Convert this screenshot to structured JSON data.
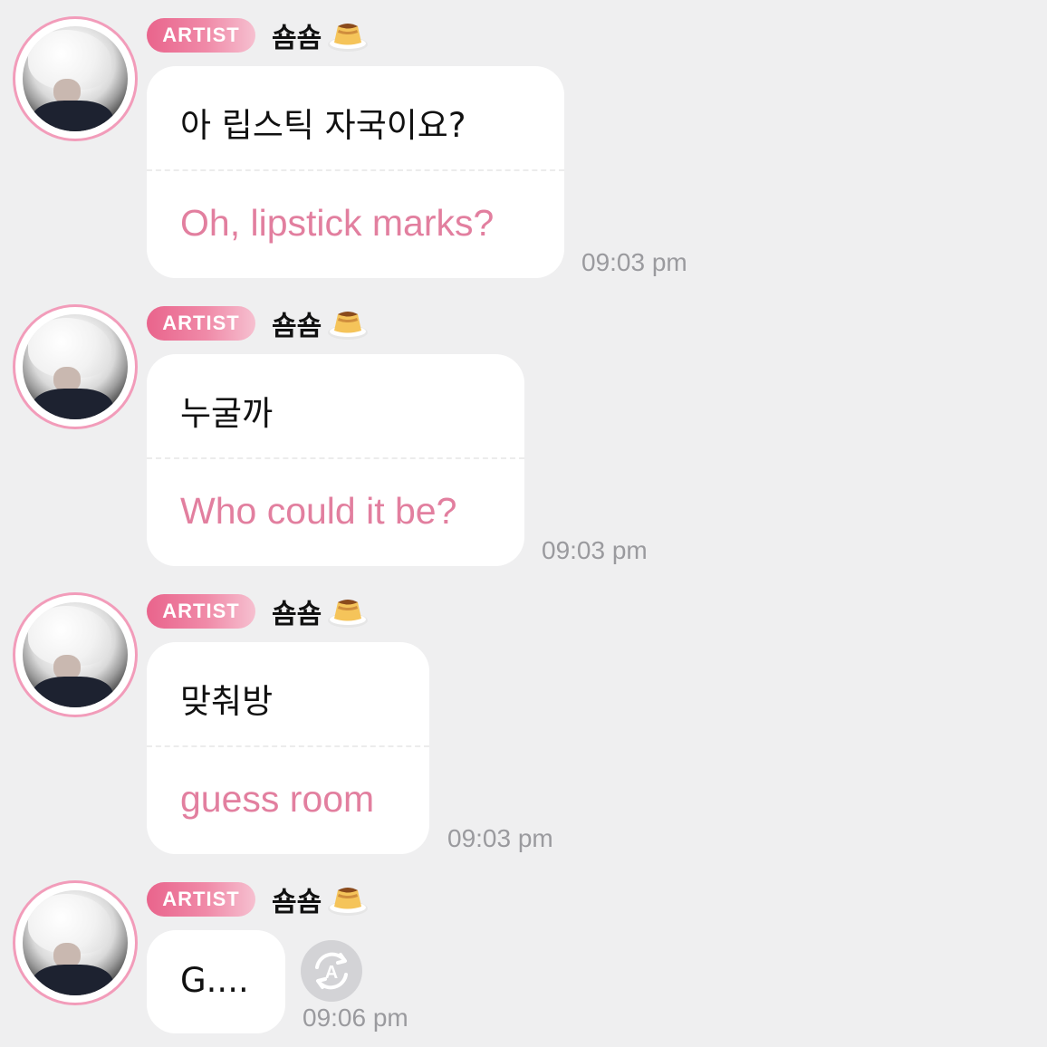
{
  "messages": [
    {
      "badge": "ARTIST",
      "username": "숌숌",
      "original": "아 립스틱 자국이요?",
      "translation": "Oh, lipstick marks?",
      "time": "09:03 pm"
    },
    {
      "badge": "ARTIST",
      "username": "숌숌",
      "original": "누굴까",
      "translation": "Who could it be?",
      "time": "09:03 pm"
    },
    {
      "badge": "ARTIST",
      "username": "숌숌",
      "original": "맞춰방",
      "translation": "guess room",
      "time": "09:03 pm"
    },
    {
      "badge": "ARTIST",
      "username": "숌숌",
      "original": "G....",
      "translation": "",
      "time": "09:06 pm"
    }
  ],
  "icons": {
    "username_emoji": "custard-pudding-icon",
    "translate_button": "translate-icon"
  },
  "colors": {
    "background": "#efeff0",
    "bubble": "#ffffff",
    "badge_gradient_start": "#e9648c",
    "translation_text": "#e27f9f",
    "timestamp": "#9a9a9e",
    "avatar_ring": "#f29cba"
  }
}
